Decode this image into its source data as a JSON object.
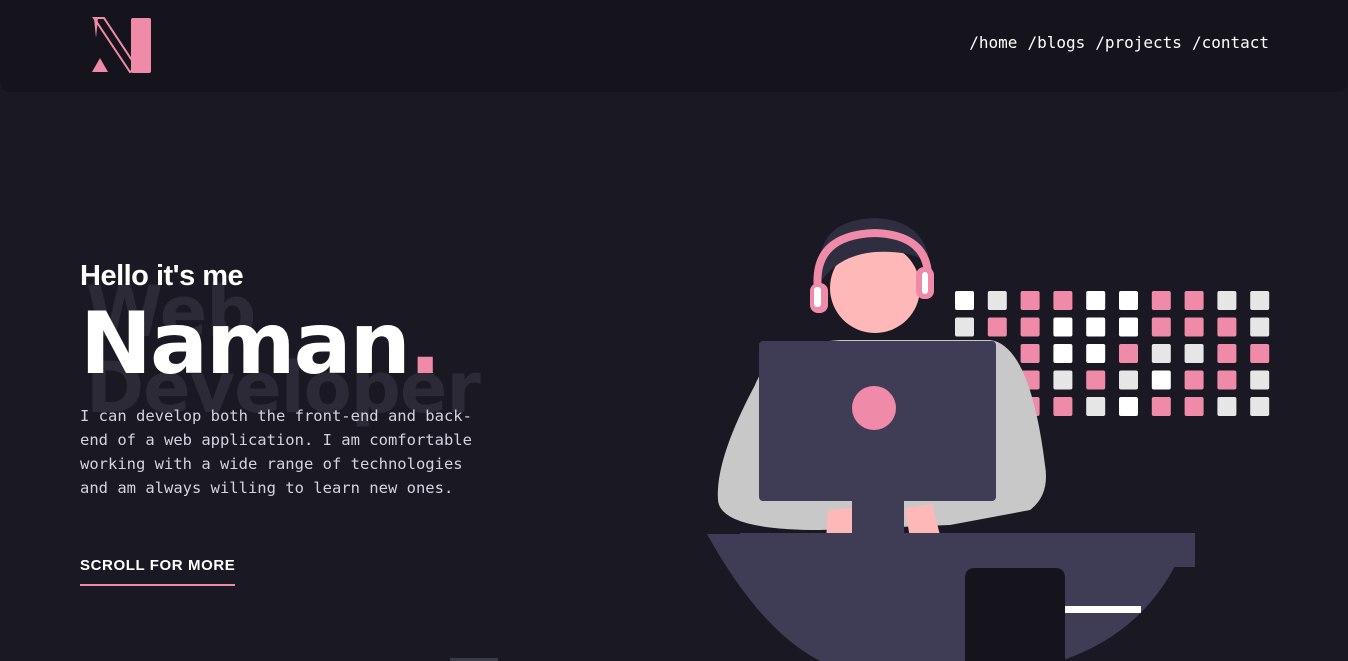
{
  "nav": {
    "logo_alt": "N logo",
    "links": [
      "/home",
      "/blogs",
      "/projects",
      "/contact"
    ]
  },
  "hero": {
    "background_words": [
      "Web",
      "Developer"
    ],
    "greeting": "Hello it's me",
    "name": "Naman",
    "name_dot": ".",
    "description": "I can develop both the front-end and back-end of a web application. I am comfortable working with a wide range of technologies and am always willing to learn new ones.",
    "cta": "SCROLL FOR MORE"
  },
  "colors": {
    "background": "#1a1923",
    "navbar": "#15141d",
    "accent": "#ef8aa8",
    "laptop": "#3f3d56",
    "shirt": "#c8c8c8",
    "skin": "#ffb8b8"
  },
  "dot_grid": {
    "rows": [
      [
        "w",
        "g",
        "p",
        "p",
        "w",
        "w",
        "p",
        "p",
        "g",
        "g"
      ],
      [
        "g",
        "p",
        "p",
        "w",
        "w",
        "w",
        "p",
        "p",
        "p",
        "g"
      ],
      [
        "",
        "",
        "p",
        "w",
        "w",
        "p",
        "g",
        "g",
        "p",
        "p"
      ],
      [
        "",
        "",
        "p",
        "g",
        "p",
        "g",
        "w",
        "p",
        "p",
        "g"
      ],
      [
        "",
        "",
        "p",
        "p",
        "g",
        "w",
        "p",
        "p",
        "g",
        "g"
      ]
    ]
  }
}
